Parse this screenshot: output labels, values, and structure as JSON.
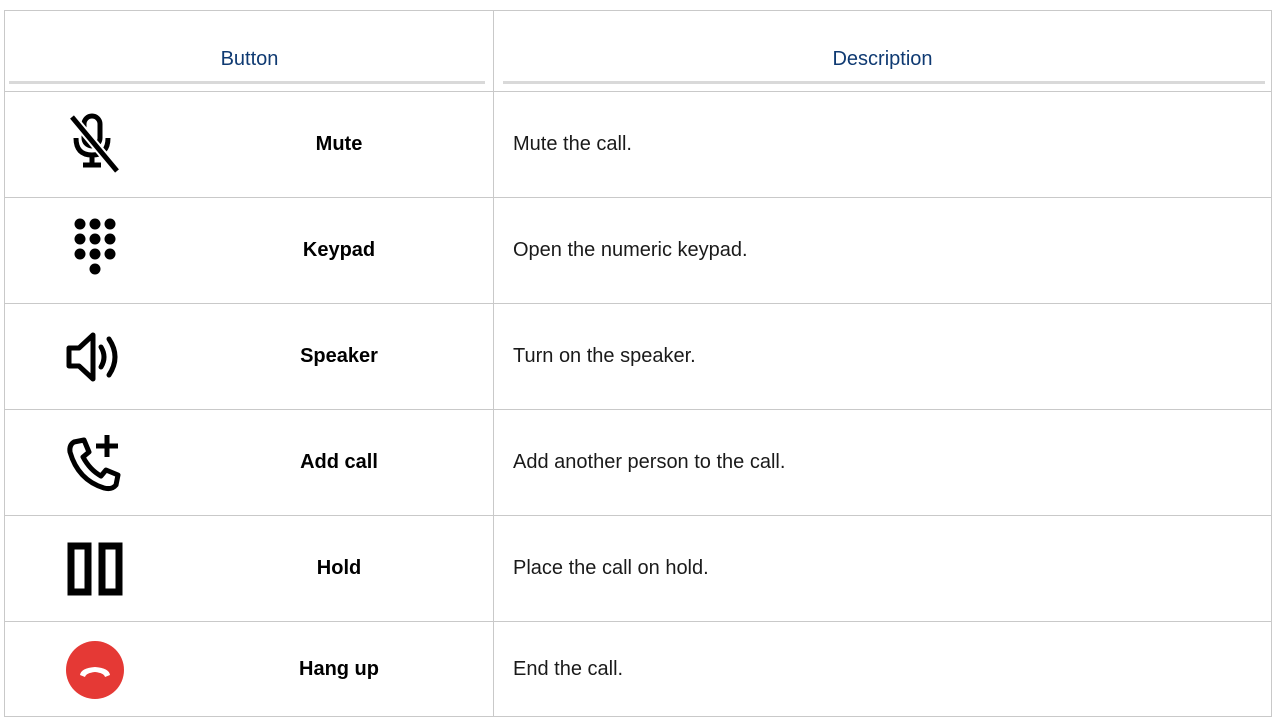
{
  "table": {
    "headers": {
      "button": "Button",
      "description": "Description"
    },
    "header_color": "#0f3a72",
    "rows": [
      {
        "icon": "mic-off-icon",
        "name": "Mute",
        "description": "Mute the call."
      },
      {
        "icon": "keypad-icon",
        "name": "Keypad",
        "description": "Open the numeric keypad."
      },
      {
        "icon": "speaker-icon",
        "name": "Speaker",
        "description": "Turn on the speaker."
      },
      {
        "icon": "add-call-icon",
        "name": "Add call",
        "description": "Add another person to the call."
      },
      {
        "icon": "pause-icon",
        "name": "Hold",
        "description": "Place the call on hold."
      },
      {
        "icon": "hang-up-icon",
        "name": "Hang up",
        "description": "End the call."
      }
    ],
    "hang_up_color": "#e53935"
  }
}
